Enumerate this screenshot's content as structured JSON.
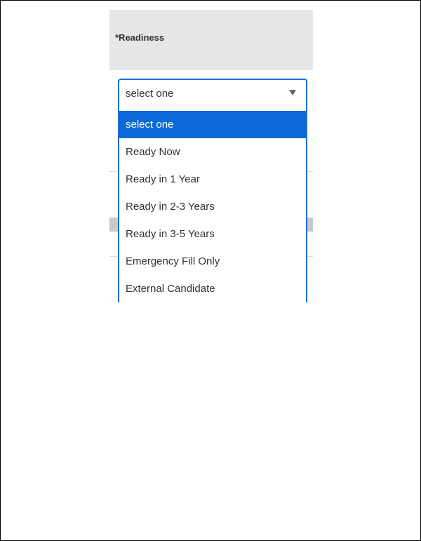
{
  "field": {
    "label": "*Readiness",
    "current_value": "select one"
  },
  "dropdown": {
    "options": [
      {
        "label": "select one",
        "highlighted": true
      },
      {
        "label": "Ready Now",
        "highlighted": false
      },
      {
        "label": "Ready in 1 Year",
        "highlighted": false
      },
      {
        "label": "Ready in 2-3 Years",
        "highlighted": false
      },
      {
        "label": "Ready in 3-5 Years",
        "highlighted": false
      },
      {
        "label": "Emergency Fill Only",
        "highlighted": false
      },
      {
        "label": "External Candidate",
        "highlighted": false
      }
    ]
  },
  "colors": {
    "accent": "#1f6fd6",
    "highlight_bg": "#0b69d8",
    "header_bg": "#e6e7e9"
  }
}
